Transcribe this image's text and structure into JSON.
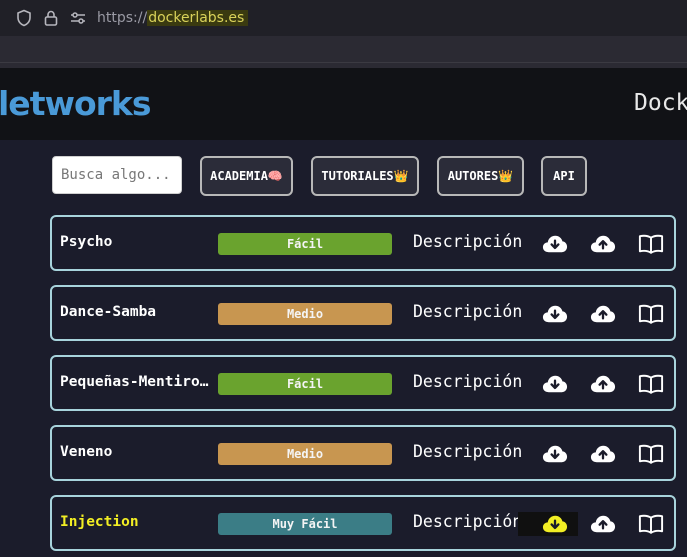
{
  "browser": {
    "url_prefix": "https://",
    "url_host": "dockerlabs.es"
  },
  "header": {
    "logo_text": "letworks",
    "right_text": "Dock"
  },
  "nav": {
    "search_placeholder": "Busca algo...",
    "buttons": [
      "ACADEMIA🧠",
      "TUTORIALES👑",
      "AUTORES👑",
      "API"
    ]
  },
  "colors": {
    "Fácil": "#6aa32e",
    "Medio": "#c89650",
    "Muy Fácil": "#3b7d86",
    "accent_highlight": "#f2ee24"
  },
  "machines": [
    {
      "name": "Psycho",
      "difficulty": "Fácil",
      "description": "Descripción"
    },
    {
      "name": "Dance-Samba",
      "difficulty": "Medio",
      "description": "Descripción"
    },
    {
      "name": "Pequeñas-Mentirosas",
      "difficulty": "Fácil",
      "description": "Descripción"
    },
    {
      "name": "Veneno",
      "difficulty": "Medio",
      "description": "Descripción"
    },
    {
      "name": "Injection",
      "difficulty": "Muy Fácil",
      "description": "Descripción",
      "highlighted": true
    }
  ],
  "icons": [
    "shield-icon",
    "lock-icon",
    "site-settings-icon",
    "cloud-download-icon",
    "cloud-upload-icon",
    "book-icon"
  ]
}
